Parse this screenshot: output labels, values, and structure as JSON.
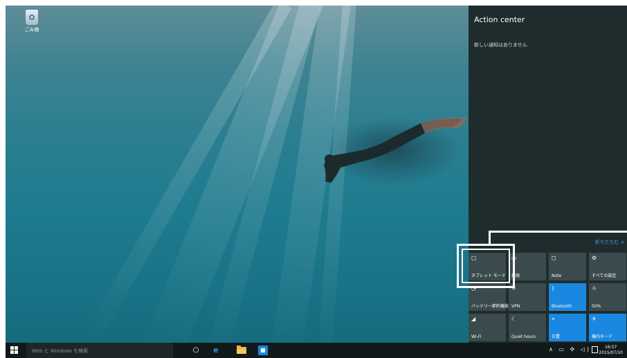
{
  "desktop": {
    "recycle_bin_label": "ごみ箱"
  },
  "action_center": {
    "title": "Action center",
    "empty_message": "新しい通知はありません",
    "collapse_label": "折りたたむ ∨",
    "tiles": [
      {
        "label": "タブレット モード",
        "icon": "tablet-icon",
        "glyph": "▢",
        "on": false
      },
      {
        "label": "接続",
        "icon": "connect-icon",
        "glyph": "▭",
        "on": false
      },
      {
        "label": "Note",
        "icon": "note-icon",
        "glyph": "◻",
        "on": false
      },
      {
        "label": "すべての設定",
        "icon": "settings-icon",
        "glyph": "⚙",
        "on": false
      },
      {
        "label": "バッテリー節約機能",
        "icon": "battery-saver-icon",
        "glyph": "◔",
        "on": false
      },
      {
        "label": "VPN",
        "icon": "vpn-icon",
        "glyph": "∞",
        "on": false
      },
      {
        "label": "Bluetooth",
        "icon": "bluetooth-icon",
        "glyph": "ᛒ",
        "on": true
      },
      {
        "label": "50%",
        "icon": "brightness-icon",
        "glyph": "☼",
        "on": false
      },
      {
        "label": "Wi-Fi",
        "icon": "wifi-icon",
        "glyph": "◢",
        "on": false
      },
      {
        "label": "Quiet hours",
        "icon": "moon-icon",
        "glyph": "☾",
        "on": false
      },
      {
        "label": "位置",
        "icon": "location-icon",
        "glyph": "⌖",
        "on": true
      },
      {
        "label": "機内モード",
        "icon": "airplane-icon",
        "glyph": "✈",
        "on": true
      }
    ]
  },
  "taskbar": {
    "search_placeholder": "Web と Windows を検索",
    "clock_time": "16:57",
    "clock_date": "2015/07/10",
    "tray_glyphs": "∧ ▭ ✣ ◁) "
  }
}
